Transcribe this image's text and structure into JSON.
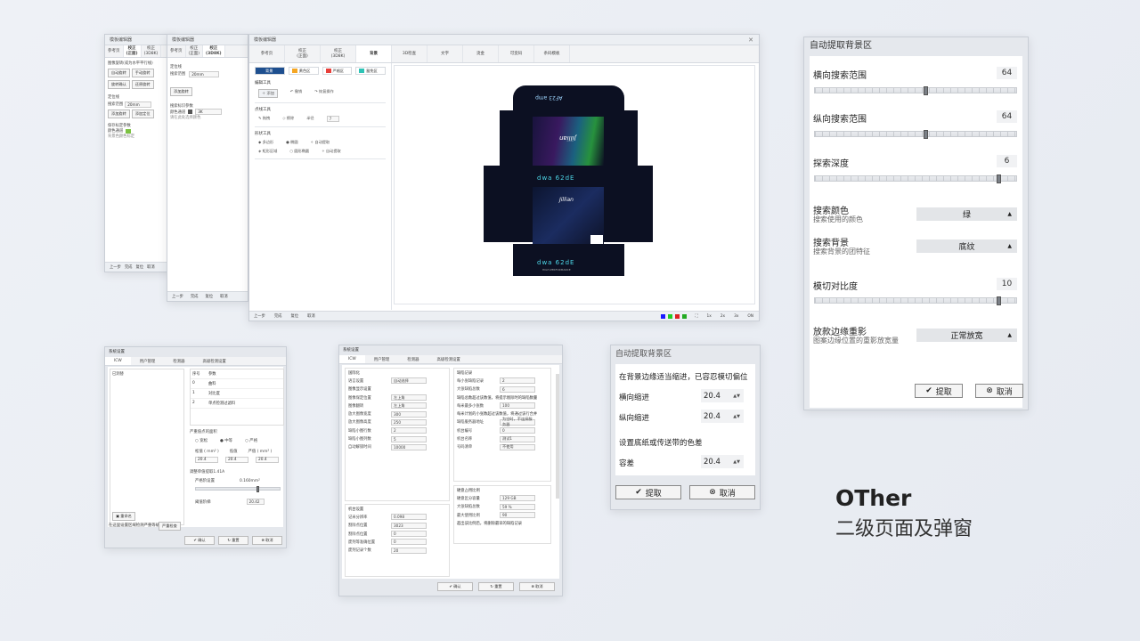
{
  "caption": {
    "title": "OTher",
    "subtitle": "二级页面及弹窗"
  },
  "editor_back1": {
    "title": "模板编辑器",
    "tabs": [
      "参考页",
      "校正\n(正面)",
      "校正\n(3D8K)"
    ],
    "labels": [
      "图像旋转(或为水平平行线)",
      "自动旋转",
      "手动旋转",
      "旋转确认",
      "还原旋转",
      "定位线",
      "搜索范围",
      "20mm",
      "添加旋转",
      "添加定位",
      "保存标定参数",
      "颜色通道",
      "背景色颜色标定"
    ],
    "bottom": [
      "上一步",
      "完成",
      "复位",
      "取消"
    ]
  },
  "editor_back2": {
    "title": "模板编辑器",
    "tabs": [
      "参考页",
      "校正\n(正面)",
      "校正\n(3D8K)"
    ],
    "labels": [
      "定位线",
      "搜索范围",
      "20mm",
      "添加旋转",
      "搜索标识参数",
      "颜色通道",
      "3K",
      "请在此处选择颜色"
    ],
    "bottom": [
      "上一步",
      "完成",
      "复位",
      "取消"
    ]
  },
  "editor_main": {
    "title": "模板编辑器",
    "tabs": [
      "参考页",
      "校正\n(正面)",
      "校正\n(3D8K)",
      "背景",
      "3D检查",
      "文字",
      "烫金",
      "可变码",
      "条码模板"
    ],
    "active_tab": "背景",
    "color_buttons": [
      {
        "label": "背景",
        "color": "#1e4f8f"
      },
      {
        "label": "黄色区",
        "color": "#f5a623"
      },
      {
        "label": "严格区",
        "color": "#e8403b"
      },
      {
        "label": "豁免区",
        "color": "#2ec4b6"
      }
    ],
    "sections": {
      "edit_tools": {
        "title": "编辑工具",
        "items": [
          "添加",
          "撤销",
          "恢复操作"
        ]
      },
      "point_tools": {
        "title": "点线工具",
        "items": [
          "拖拽",
          "擦除",
          "半径",
          "7"
        ]
      },
      "shape_tools": {
        "title": "形状工具",
        "items": [
          "多边形",
          "椭圆",
          "自动提取",
          "矩形区域",
          "圆形椭圆",
          "自动提取"
        ]
      }
    },
    "bottom": [
      "上一步",
      "完成",
      "复位",
      "取消"
    ],
    "zoom": [
      "1x",
      "2x",
      "3x",
      "ON"
    ],
    "status_colors": [
      "#1a1aff",
      "#22cc22",
      "#dd2222",
      "#22aa22"
    ],
    "package_texts": [
      "dwa 62dE",
      "dwa 62dE",
      "AF23 amp",
      "Jillian",
      "Jillian",
      "HIGH-PERFORMANCE"
    ]
  },
  "dialog_extract": {
    "title": "自动提取背景区",
    "rows": [
      {
        "label": "横向搜索范围",
        "value": "64",
        "pos": 0.55
      },
      {
        "label": "纵向搜索范围",
        "value": "64",
        "pos": 0.55
      },
      {
        "label": "探索深度",
        "value": "6",
        "pos": 0.92
      }
    ],
    "dropdowns": [
      {
        "label": "搜索颜色",
        "sub": "搜索使用的颜色",
        "value": "绿"
      },
      {
        "label": "搜索背景",
        "sub": "搜索背景的团特征",
        "value": "底纹"
      }
    ],
    "contrast": {
      "label": "模切对比度",
      "value": "10",
      "pos": 0.92
    },
    "edge": {
      "label": "放款边缘重影",
      "sub": "图案边缘位置的重影放宽量",
      "value": "正常放宽"
    },
    "ok": "提取",
    "cancel": "取消"
  },
  "dialog_small": {
    "title": "自动提取背景区",
    "note1": "在背景边缘适当缩进，已容忍模切偏位",
    "h_label": "横向缩进",
    "h_value": "20.4",
    "v_label": "纵向缩进",
    "v_value": "20.4",
    "note2": "设置底纸或传送带的色差",
    "tol_label": "容差",
    "tol_value": "20.4",
    "ok": "提取",
    "cancel": "取消"
  },
  "sys1": {
    "title": "系统设置",
    "tabs": [
      "ICW",
      "用户管理",
      "检测器",
      "高级检测设置"
    ],
    "list_head": [
      "序号",
      "参数"
    ],
    "list_rows": [
      [
        "0",
        "曲料"
      ],
      [
        "1",
        "对比度"
      ],
      [
        "2",
        "单点检测过滤料"
      ]
    ],
    "left_item": "已洞替",
    "labels": [
      "严重值点的面积",
      "宽松",
      "中等",
      "严格",
      "松值 ( mm² )",
      "低值",
      "严值 ( mm² )",
      "20.4",
      "20.4",
      "20.4",
      "调整单值提取1.41A",
      "严格阶设置",
      "0.160mm²",
      "阈值阶梯",
      "20.42"
    ],
    "bottom_left": "重命名",
    "bottom_note": "在这里设置区域检测严重等级",
    "bottom_btn": "严重检查",
    "ok": "确认",
    "reset": "重置",
    "cancel": "取消"
  },
  "sys2": {
    "title": "系统设置",
    "tabs": [
      "ICW",
      "用户管理",
      "检测器",
      "高级检测设置"
    ],
    "left": [
      [
        "国际化",
        ""
      ],
      [
        "语言设置",
        "自动选择"
      ],
      [
        "图像显示设置",
        ""
      ],
      [
        "图像保定位置",
        "左上角"
      ],
      [
        "图像翻转",
        "左上角"
      ],
      [
        "放大图像宽度",
        "300"
      ],
      [
        "放大图像高度",
        "250"
      ],
      [
        "缺陷小图行数",
        "2"
      ],
      [
        "缺陷小图列数",
        "5"
      ],
      [
        "自动解锁时间",
        "10000"
      ],
      [
        "机台设置",
        ""
      ],
      [
        "记米分辨率",
        "0.098"
      ],
      [
        "割除点位置",
        "3023"
      ],
      [
        "割除点位置",
        "0"
      ],
      [
        "废剂等准确位置",
        "0"
      ],
      [
        "废剂记录个数",
        "20"
      ]
    ],
    "right": [
      [
        "缺陷记录",
        ""
      ],
      [
        "每小张缺陷记录",
        "2"
      ],
      [
        "大张缺陷总数",
        "6"
      ],
      [
        "缺陷总数超过该数值，将提示剔除时的缺陷数量",
        ""
      ],
      [
        "每米最多小张数",
        "100"
      ],
      [
        "每米计划的小张数超过该数值，将通过该行合并",
        ""
      ],
      [
        "缺陷服务器地址",
        "为空时，不连接服务器"
      ],
      [
        "机台编号",
        "0"
      ],
      [
        "机台名称",
        "测试1"
      ],
      [
        "号码清单",
        "不使用"
      ],
      [
        "硬盘占用比例",
        ""
      ],
      [
        "硬盘区分容量",
        "129 GB"
      ],
      [
        "大张缺陷总数",
        "59 %"
      ],
      [
        "最大使用比例",
        "90"
      ],
      [
        "超出该比例后，将删除最早的缺陷记录",
        ""
      ]
    ],
    "units": [
      "像素",
      "像素",
      "个",
      "个",
      "毫秒",
      "mm",
      "mm",
      "mm",
      "mm",
      "张"
    ],
    "ok": "确认",
    "reset": "重置",
    "cancel": "取消"
  }
}
